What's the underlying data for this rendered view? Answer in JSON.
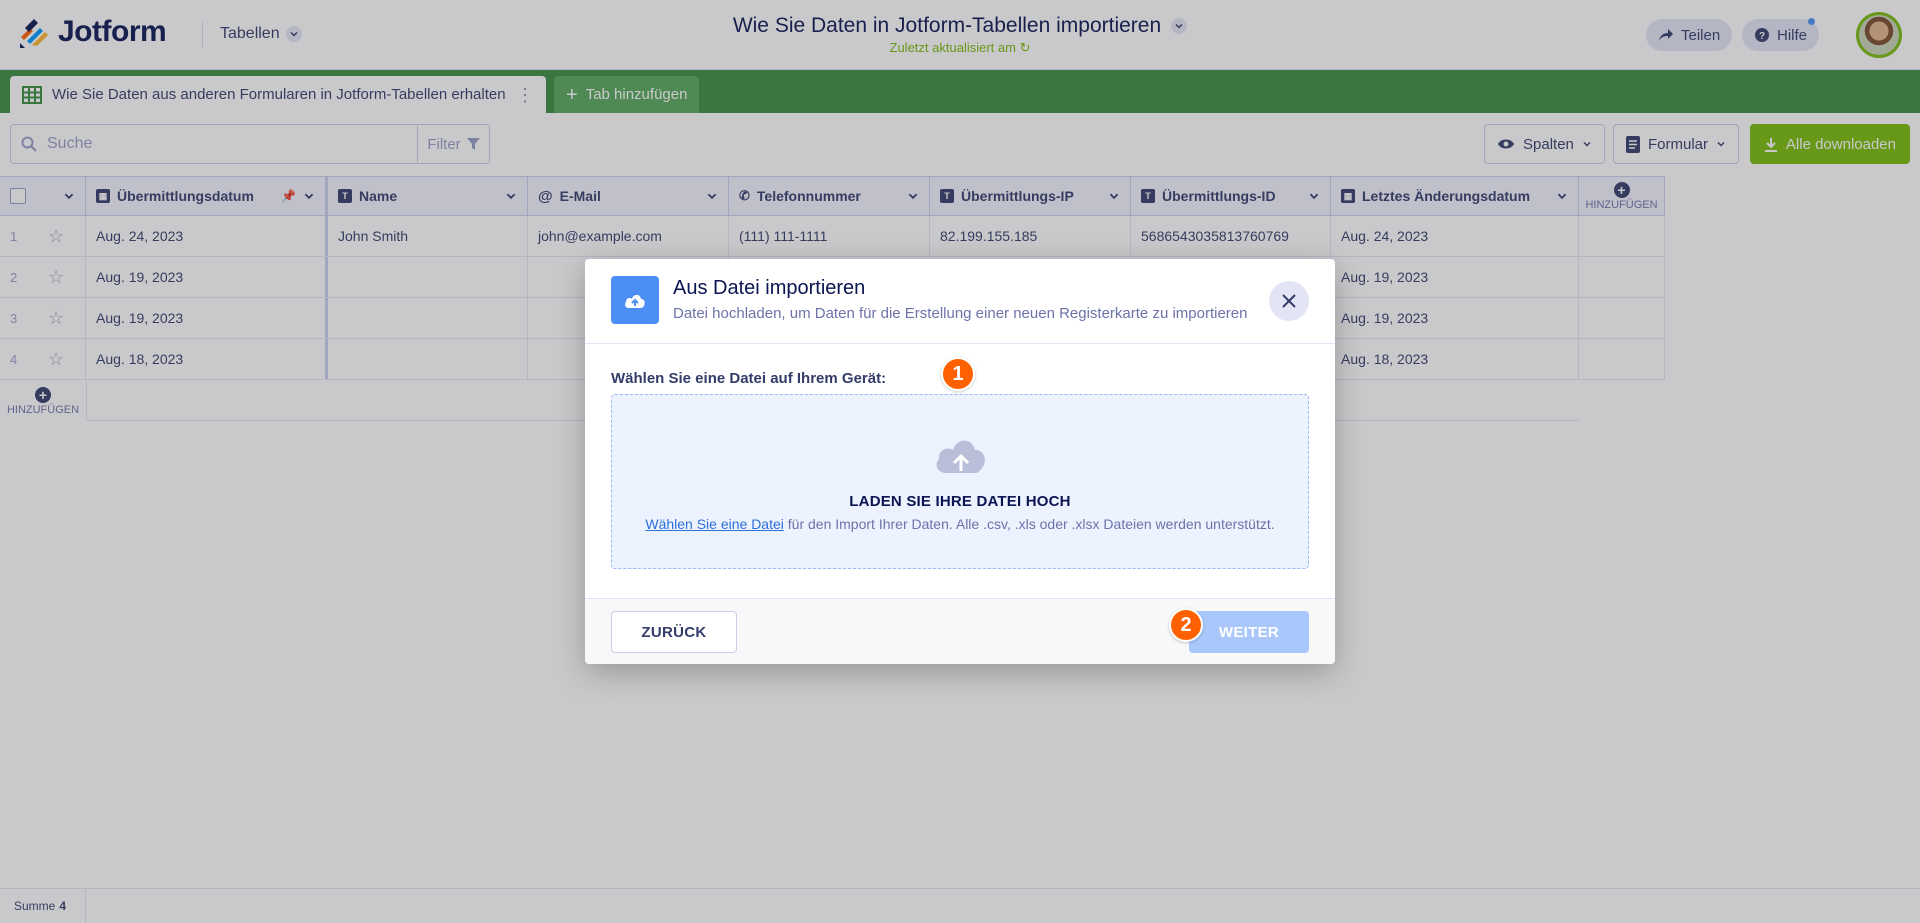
{
  "header": {
    "logo_text": "Jotform",
    "app_switch_label": "Tabellen",
    "title": "Wie Sie Daten in Jotform-Tabellen importieren",
    "subtitle": "Zuletzt aktualisiert am",
    "share_label": "Teilen",
    "help_label": "Hilfe"
  },
  "tabs": {
    "active_label": "Wie Sie Daten aus anderen Formularen in Jotform-Tabellen erhalten",
    "add_label": "Tab hinzufügen"
  },
  "toolbar": {
    "search_placeholder": "Suche",
    "filter_label": "Filter",
    "columns_label": "Spalten",
    "form_label": "Formular",
    "download_label": "Alle downloaden"
  },
  "table": {
    "columns": [
      {
        "label": "Übermittlungsdatum",
        "icon": "calendar-icon"
      },
      {
        "label": "Name",
        "icon": "text-icon"
      },
      {
        "label": "E-Mail",
        "icon": "at-icon"
      },
      {
        "label": "Telefonnummer",
        "icon": "phone-icon"
      },
      {
        "label": "Übermittlungs-IP",
        "icon": "text-icon"
      },
      {
        "label": "Übermittlungs-ID",
        "icon": "text-icon"
      },
      {
        "label": "Letztes Änderungsdatum",
        "icon": "calendar-icon"
      }
    ],
    "add_column_label": "HINZUFÜGEN",
    "add_row_label": "HINZUFÜGEN",
    "rows": [
      {
        "num": "1",
        "cells": [
          "Aug. 24, 2023",
          "John Smith",
          "john@example.com",
          "(111) 111-1111",
          "82.199.155.185",
          "5686543035813760769",
          "Aug. 24, 2023"
        ]
      },
      {
        "num": "2",
        "cells": [
          "Aug. 19, 2023",
          "",
          "",
          "",
          "",
          "",
          "Aug. 19, 2023"
        ]
      },
      {
        "num": "3",
        "cells": [
          "Aug. 19, 2023",
          "",
          "",
          "",
          "",
          "",
          "Aug. 19, 2023"
        ]
      },
      {
        "num": "4",
        "cells": [
          "Aug. 18, 2023",
          "",
          "",
          "",
          "",
          "",
          "Aug. 18, 2023"
        ]
      }
    ]
  },
  "footer": {
    "sum_label": "Summe",
    "sum_value": "4"
  },
  "modal": {
    "title": "Aus Datei importieren",
    "subtitle": "Datei hochladen, um Daten für die Erstellung einer neuen Registerkarte zu importieren",
    "choose_label": "Wählen Sie eine Datei auf Ihrem Gerät:",
    "dropzone_title": "LADEN SIE IHRE DATEI HOCH",
    "dropzone_link": "Wählen Sie eine Datei",
    "dropzone_text": " für den Import Ihrer Daten. Alle .csv, .xls oder .xlsx Dateien werden unterstützt.",
    "back_label": "ZURÜCK",
    "next_label": "WEITER"
  },
  "markers": {
    "first": "1",
    "second": "2"
  },
  "colors": {
    "brand_green": "#3a8d3e",
    "accent_blue": "#4c8ff4",
    "marker_orange": "#ff6100",
    "download_green": "#78bb07"
  }
}
